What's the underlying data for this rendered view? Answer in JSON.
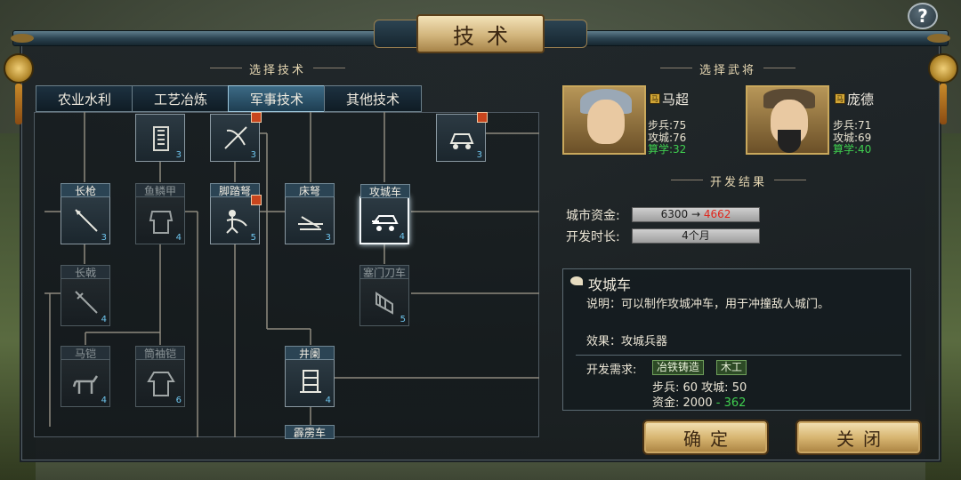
{
  "title": "技术",
  "help": "?",
  "left_header": "选择技术",
  "right_header": "选择武将",
  "result_header": "开发结果",
  "tabs": [
    {
      "label": "农业水利"
    },
    {
      "label": "工艺冶炼"
    },
    {
      "label": "军事技术"
    },
    {
      "label": "其他技术"
    }
  ],
  "nodes": [
    {
      "label": "",
      "level": "3"
    },
    {
      "label": "",
      "level": "3"
    },
    {
      "label": "",
      "level": "3"
    },
    {
      "label": "长枪",
      "level": "3"
    },
    {
      "label": "鱼鳞甲",
      "level": "4"
    },
    {
      "label": "脚踏弩",
      "level": "5"
    },
    {
      "label": "床弩",
      "level": "3"
    },
    {
      "label": "攻城车",
      "level": "4"
    },
    {
      "label": "长戟",
      "level": "4"
    },
    {
      "label": "塞门刀车",
      "level": "5"
    },
    {
      "label": "马铠",
      "level": "4"
    },
    {
      "label": "筒袖铠",
      "level": "6"
    },
    {
      "label": "井阑",
      "level": "4"
    },
    {
      "label": "霹雳车",
      "level": ""
    }
  ],
  "generals": [
    {
      "badge": "马",
      "name": "马超",
      "infantry": "步兵:75",
      "siege": "攻城:76",
      "arith": "算学:32"
    },
    {
      "badge": "马",
      "name": "庞德",
      "infantry": "步兵:71",
      "siege": "攻城:69",
      "arith": "算学:40"
    }
  ],
  "result": {
    "funds_label": "城市资金:",
    "funds_from": "6300 →",
    "funds_to": "4662",
    "time_label": "开发时长:",
    "time_value": "4个月"
  },
  "detail": {
    "name": "攻城车",
    "desc": "说明：可以制作攻城冲车，用于冲撞敌人城门。",
    "effect": "效果：攻城兵器",
    "req_label": "开发需求:",
    "req_tags": [
      "冶铁铸造",
      "木工"
    ],
    "req_stats": "步兵: 60 攻城: 50",
    "req_cost": "资金: 2000",
    "req_cost_delta": "- 362"
  },
  "buttons": {
    "confirm": "确定",
    "close": "关闭"
  },
  "colors": {
    "selected_tab": "#3c6a85",
    "gold": "#d8b672",
    "increase": "#3fcf4f",
    "decrease": "#e0261c",
    "level": "#6fc6ef"
  }
}
